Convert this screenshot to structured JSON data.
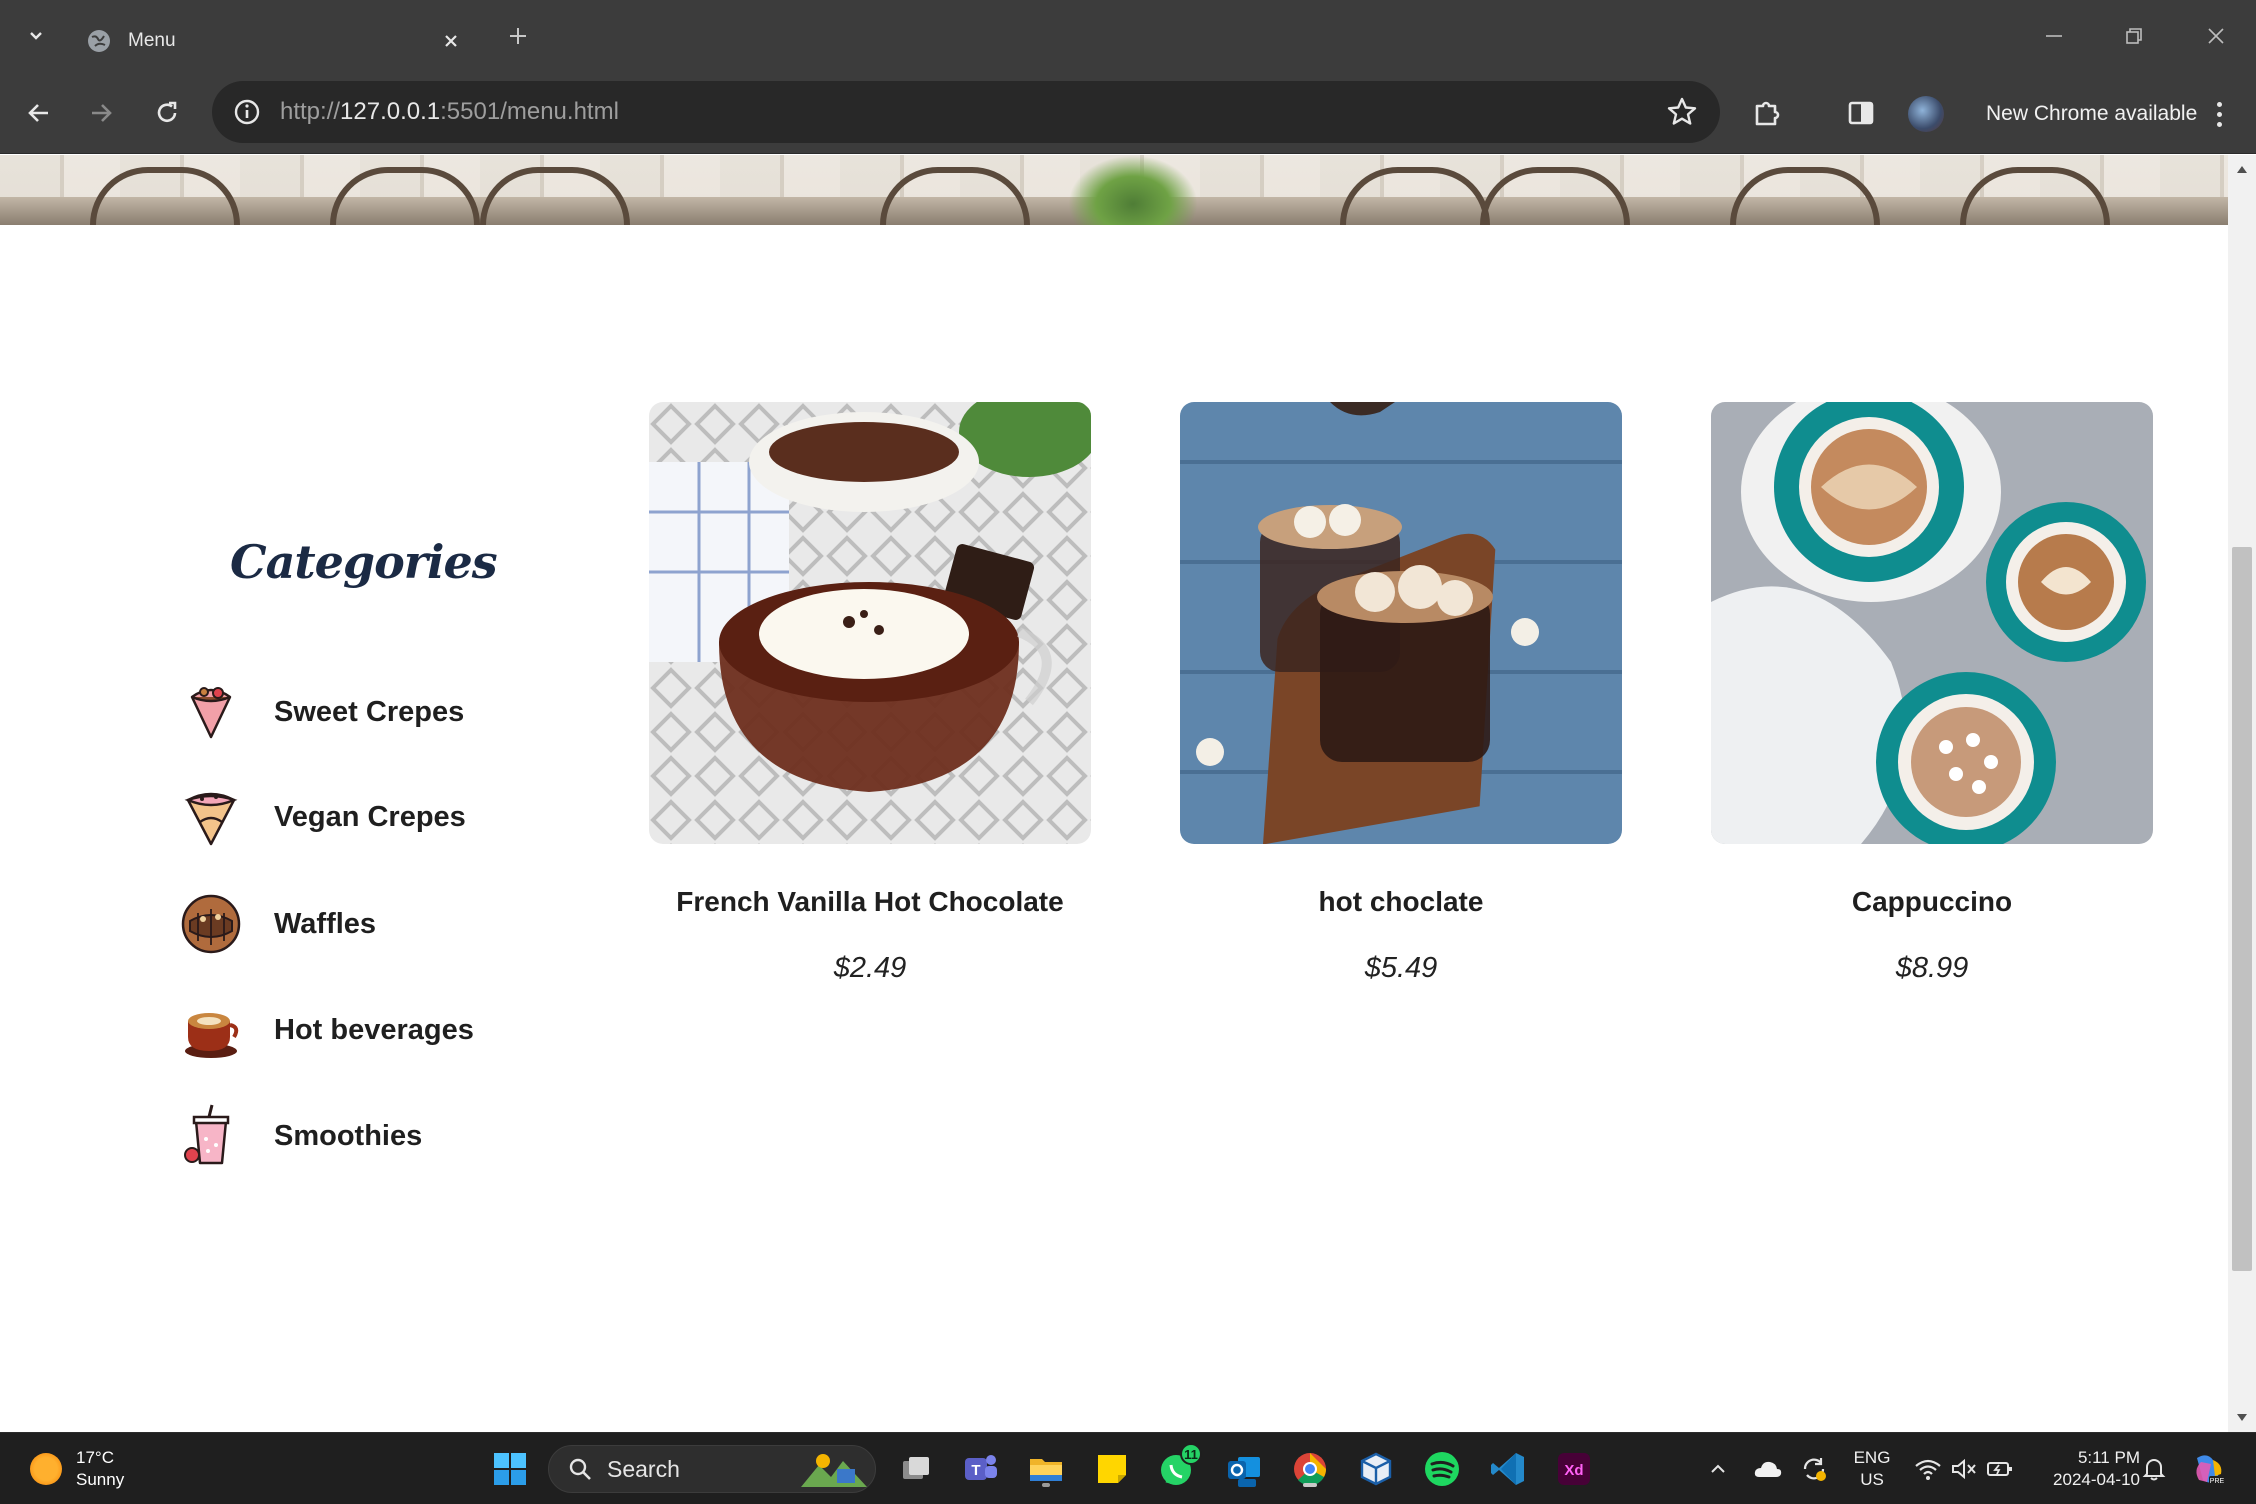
{
  "browser": {
    "tab_title": "Menu",
    "url_scheme": "http://",
    "url_host": "127.0.0.1",
    "url_rest": ":5501/menu.html",
    "update_label": "New Chrome available"
  },
  "sidebar": {
    "title": "Categories",
    "items": [
      {
        "label": "Sweet Crepes",
        "icon": "crepe-icon"
      },
      {
        "label": "Vegan Crepes",
        "icon": "vegan-crepe-icon"
      },
      {
        "label": "Waffles",
        "icon": "waffle-icon"
      },
      {
        "label": "Hot beverages",
        "icon": "coffee-cup-icon"
      },
      {
        "label": "Smoothies",
        "icon": "smoothie-icon"
      }
    ]
  },
  "products": [
    {
      "name": "French Vanilla Hot Chocolate",
      "price": "$2.49"
    },
    {
      "name": "hot choclate",
      "price": "$5.49"
    },
    {
      "name": "Cappuccino",
      "price": "$8.99"
    }
  ],
  "taskbar": {
    "weather_temp": "17°C",
    "weather_desc": "Sunny",
    "search_label": "Search",
    "whatsapp_badge": "11",
    "lang_top": "ENG",
    "lang_bottom": "US",
    "time": "5:11 PM",
    "date": "2024-04-10"
  },
  "colors": {
    "chrome_bg": "#3c3c3c",
    "heading": "#1b2a44",
    "taskbar_bg": "#1f1f1f"
  }
}
